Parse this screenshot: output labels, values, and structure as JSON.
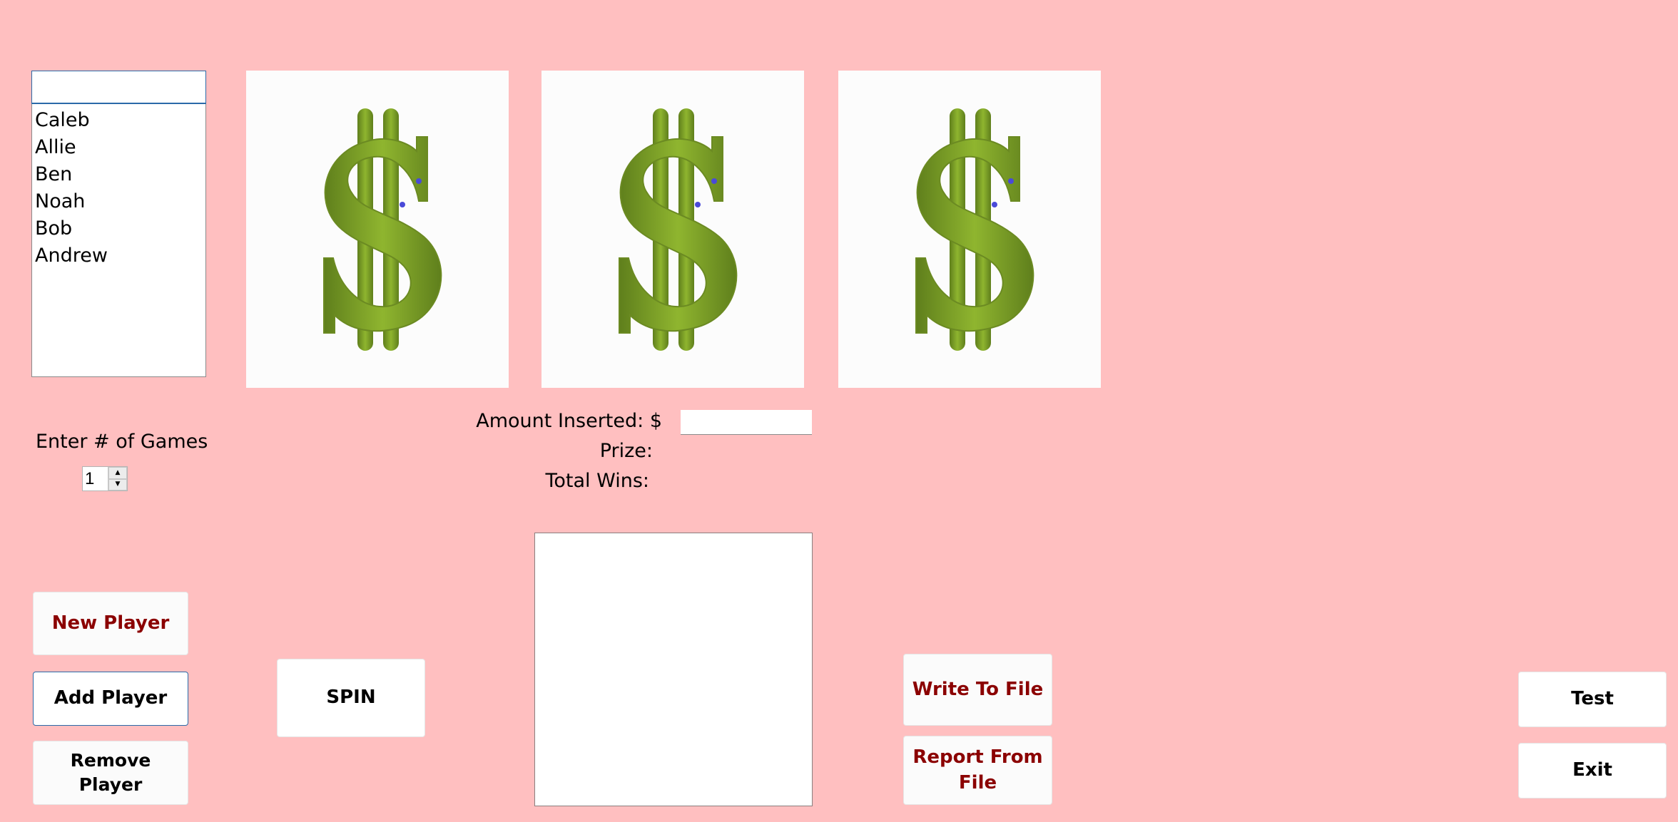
{
  "players": {
    "name_input_value": "",
    "list": [
      "Caleb",
      "Allie",
      "Ben",
      "Noah",
      "Bob",
      "Andrew"
    ]
  },
  "games": {
    "label": "Enter # of Games",
    "value": "1",
    "up_icon": "triangle-up",
    "down_icon": "triangle-down"
  },
  "reels": [
    {
      "symbol": "dollar-sign"
    },
    {
      "symbol": "dollar-sign"
    },
    {
      "symbol": "dollar-sign"
    }
  ],
  "stats": {
    "amount_label": "Amount Inserted: $",
    "amount_value": "",
    "prize_label": "Prize:",
    "prize_value": "",
    "wins_label": "Total Wins:",
    "wins_value": ""
  },
  "output": {
    "items": []
  },
  "buttons": {
    "new_player": "New Player",
    "add_player": "Add Player",
    "remove_player": "Remove Player",
    "spin": "SPIN",
    "write_to_file": "Write To File",
    "report_from_file": "Report From File",
    "test": "Test",
    "exit": "Exit"
  },
  "colors": {
    "background": "#ffbfc0",
    "accent_text": "#8b0000",
    "focus_border": "#2a6aa8",
    "dollar_green": "#7fa32a"
  }
}
